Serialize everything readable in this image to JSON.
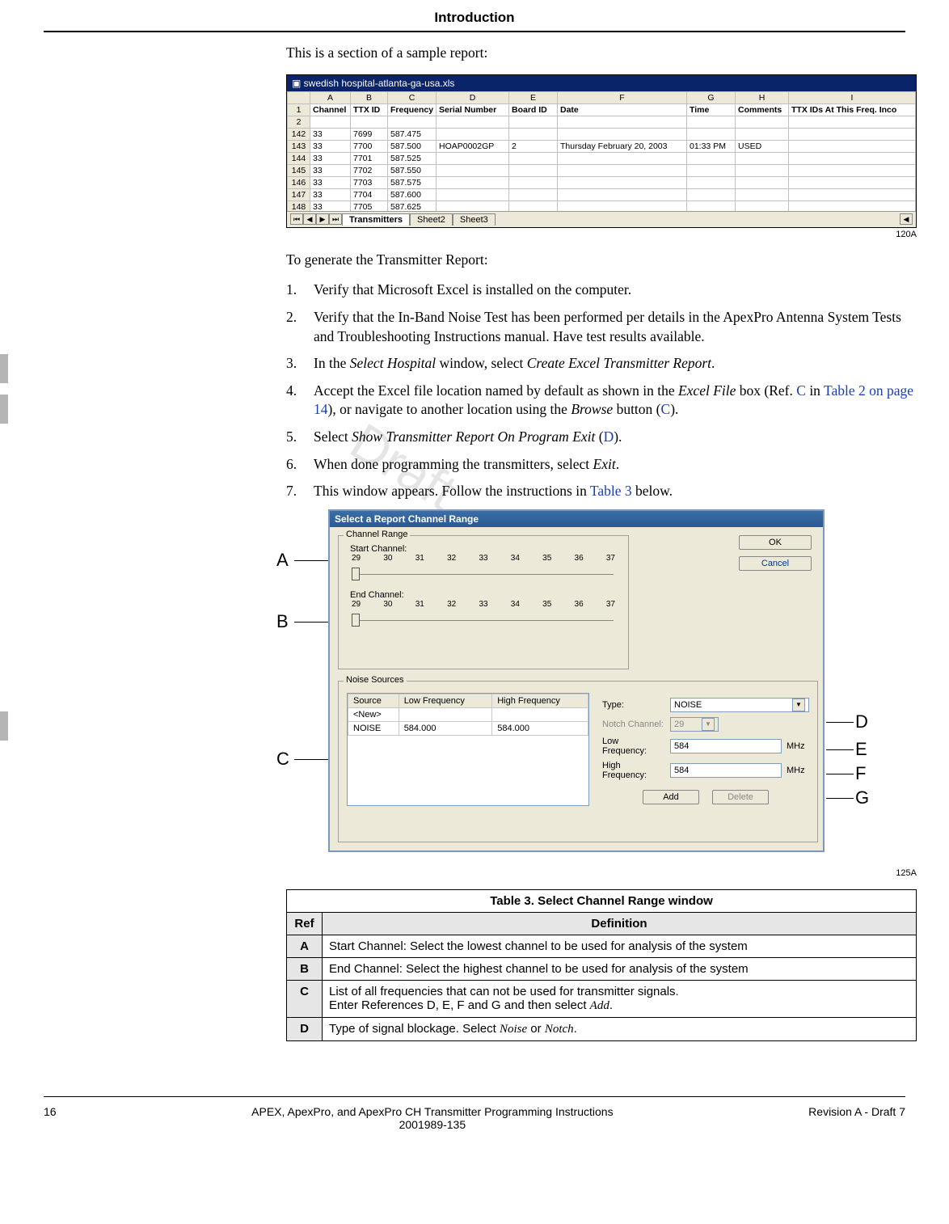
{
  "header": {
    "title": "Introduction"
  },
  "intro_text": "This is a section of a sample report:",
  "excel": {
    "filename": "swedish hospital-atlanta-ga-usa.xls",
    "columns": [
      "",
      "A",
      "B",
      "C",
      "D",
      "E",
      "F",
      "G",
      "H",
      "I"
    ],
    "header_row": [
      "",
      "Channel",
      "TTX ID",
      "Frequency",
      "Serial Number",
      "Board ID",
      "Date",
      "Time",
      "Comments",
      "TTX IDs At This Freq.  Inco"
    ],
    "rows": [
      {
        "n": "142",
        "cells": [
          "33",
          "7699",
          "587.475",
          "",
          "",
          "",
          "",
          "",
          ""
        ]
      },
      {
        "n": "143",
        "cells": [
          "33",
          "7700",
          "587.500",
          "HOAP0002GP",
          "2",
          "Thursday February 20, 2003",
          "01:33 PM",
          "USED",
          ""
        ]
      },
      {
        "n": "144",
        "cells": [
          "33",
          "7701",
          "587.525",
          "",
          "",
          "",
          "",
          "",
          ""
        ]
      },
      {
        "n": "145",
        "cells": [
          "33",
          "7702",
          "587.550",
          "",
          "",
          "",
          "",
          "",
          ""
        ]
      },
      {
        "n": "146",
        "cells": [
          "33",
          "7703",
          "587.575",
          "",
          "",
          "",
          "",
          "",
          ""
        ]
      },
      {
        "n": "147",
        "cells": [
          "33",
          "7704",
          "587.600",
          "",
          "",
          "",
          "",
          "",
          ""
        ]
      },
      {
        "n": "148",
        "cells": [
          "33",
          "7705",
          "587.625",
          "",
          "",
          "",
          "",
          "",
          ""
        ]
      }
    ],
    "sheets": {
      "active": "Transmitters",
      "others": [
        "Sheet2",
        "Sheet3"
      ]
    },
    "fig_label": "120A"
  },
  "generate_heading": "To generate the Transmitter Report:",
  "steps": {
    "s1": "Verify that Microsoft Excel is installed on the computer.",
    "s2": "Verify that the In-Band Noise Test has been performed per details in the ApexPro Antenna System Tests and Troubleshooting Instructions manual. Have test results available.",
    "s3_pre": "In the ",
    "s3_win": "Select Hospital",
    "s3_mid": " window, select ",
    "s3_opt": "Create Excel Transmitter Report",
    "s3_post": ".",
    "s4_pre": "Accept the Excel file location named by default as shown in the ",
    "s4_em1": "Excel File",
    "s4_mid1": " box (Ref. ",
    "s4_link1": "C",
    "s4_mid2": " in ",
    "s4_link2": "Table 2 on page 14",
    "s4_mid3": "), or navigate to another location using the ",
    "s4_em2": "Browse",
    "s4_mid4": " button (",
    "s4_link3": "C",
    "s4_post": ").",
    "s5_pre": "Select ",
    "s5_em": "Show Transmitter Report On Program Exit",
    "s5_post": " (",
    "s5_link": "D",
    "s5_post2": ").",
    "s6_pre": "When done programming the transmitters, select ",
    "s6_em": "Exit",
    "s6_post": ".",
    "s7_pre": "This window appears. Follow the instructions in ",
    "s7_link": "Table 3",
    "s7_post": " below."
  },
  "dialog": {
    "title": "Select a Report Channel Range",
    "channel_range_legend": "Channel Range",
    "start_label": "Start Channel:",
    "end_label": "End Channel:",
    "ticks": [
      "29",
      "30",
      "31",
      "32",
      "33",
      "34",
      "35",
      "36",
      "37"
    ],
    "ok": "OK",
    "cancel": "Cancel",
    "noise_sources_legend": "Noise Sources",
    "ns_headers": [
      "Source",
      "Low Frequency",
      "High Frequency"
    ],
    "ns_rows": [
      [
        "<New>",
        "",
        ""
      ],
      [
        "NOISE",
        "584.000",
        "584.000"
      ]
    ],
    "type_label": "Type:",
    "type_value": "NOISE",
    "notch_label": "Notch Channel:",
    "notch_value": "29",
    "low_label": "Low Frequency:",
    "low_value": "584",
    "high_label": "High Frequency:",
    "high_value": "584",
    "unit": "MHz",
    "add": "Add",
    "delete": "Delete",
    "fig_label": "125A"
  },
  "callouts": {
    "A": "A",
    "B": "B",
    "C": "C",
    "D": "D",
    "E": "E",
    "F": "F",
    "G": "G"
  },
  "table3": {
    "title": "Table 3. Select Channel Range window",
    "ref_hdr": "Ref",
    "def_hdr": "Definition",
    "rows": [
      {
        "ref": "A",
        "def_pre": "Start Channel: Select the lowest channel to be used for analysis of the system"
      },
      {
        "ref": "B",
        "def_pre": "End Channel: Select the highest channel to be used for analysis of the system"
      },
      {
        "ref": "C",
        "def_pre": "List of all frequencies that can not be used for transmitter signals.\nEnter References D, E, F and G and then select ",
        "def_em": "Add",
        "def_post": "."
      },
      {
        "ref": "D",
        "def_pre": "Type of signal blockage. Select ",
        "def_em": "Noise",
        "def_mid": " or ",
        "def_em2": "Notch",
        "def_post": "."
      }
    ]
  },
  "footer": {
    "page": "16",
    "center1": "APEX, ApexPro, and ApexPro CH Transmitter Programming Instructions",
    "center2": "2001989-135",
    "right": "Revision A - Draft 7"
  },
  "watermark": "Draft"
}
